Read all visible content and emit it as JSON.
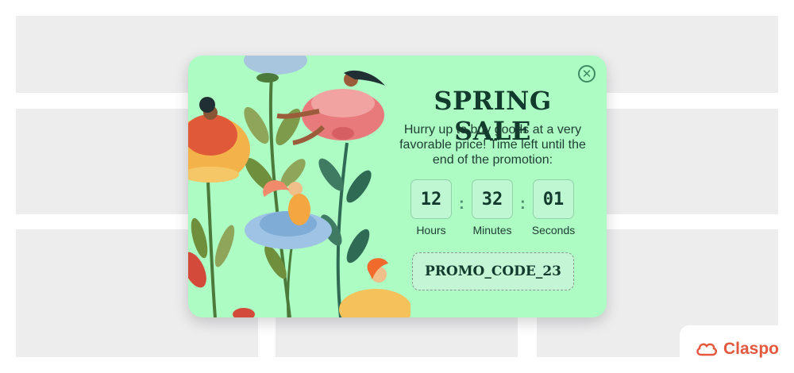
{
  "popup": {
    "title": "SPRING SALE",
    "description": "Hurry up to buy goods at a very favorable price! Time left until the end of the promotion:",
    "close_icon": "close-icon",
    "timer": {
      "hours": "12",
      "minutes": "32",
      "seconds": "01",
      "separator": ":",
      "hours_label": "Hours",
      "minutes_label": "Minutes",
      "seconds_label": "Seconds"
    },
    "promo_code": "PROMO_CODE_23"
  },
  "brand": {
    "name": "Claspo",
    "icon": "cloud-icon"
  },
  "colors": {
    "popup_bg": "#adfcc3",
    "title": "#123a2d",
    "brand": "#e6583e",
    "placeholder": "#ededee"
  }
}
